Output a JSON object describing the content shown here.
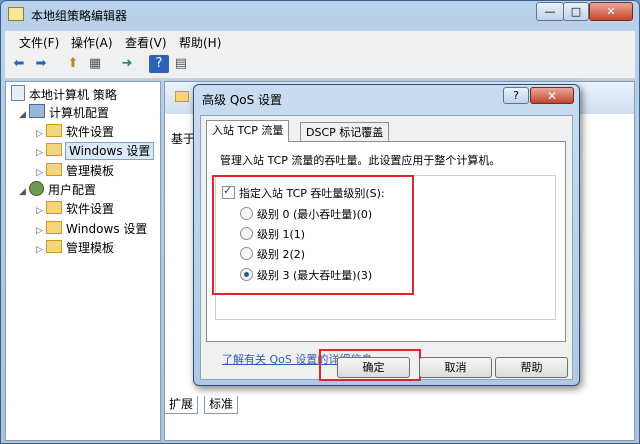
{
  "window": {
    "title": "本地组策略编辑器",
    "min": "—",
    "max": "□",
    "close": "✕"
  },
  "menu": [
    "文件(F)",
    "操作(A)",
    "查看(V)",
    "帮助(H)"
  ],
  "tree": {
    "root": "本地计算机 策略",
    "computer": "计算机配置",
    "computer_children": [
      "软件设置",
      "Windows 设置",
      "管理模板"
    ],
    "user": "用户配置",
    "user_children": [
      "软件设置",
      "Windows 设置",
      "管理模板"
    ]
  },
  "right_panel": {
    "label": "基于"
  },
  "bottom_tabs": [
    "扩展",
    "标准"
  ],
  "dialog": {
    "title": "高级 QoS 设置",
    "help": "?",
    "close": "✕",
    "tabs": [
      "入站 TCP 流量",
      "DSCP 标记覆盖"
    ],
    "description": "管理入站 TCP 流量的吞吐量。此设置应用于整个计算机。",
    "checkbox_label": "指定入站 TCP 吞吐量级别(S):",
    "checkbox_checked": true,
    "options": [
      "级别 0 (最小吞吐量)(0)",
      "级别 1(1)",
      "级别 2(2)",
      "级别 3 (最大吞吐量)(3)"
    ],
    "selected_option": 3,
    "link": "了解有关 QoS 设置的详细信息",
    "buttons": {
      "ok": "确定",
      "cancel": "取消",
      "help": "帮助"
    }
  },
  "colors": {
    "highlight": "#e0252b",
    "link": "#2f5fb3"
  }
}
